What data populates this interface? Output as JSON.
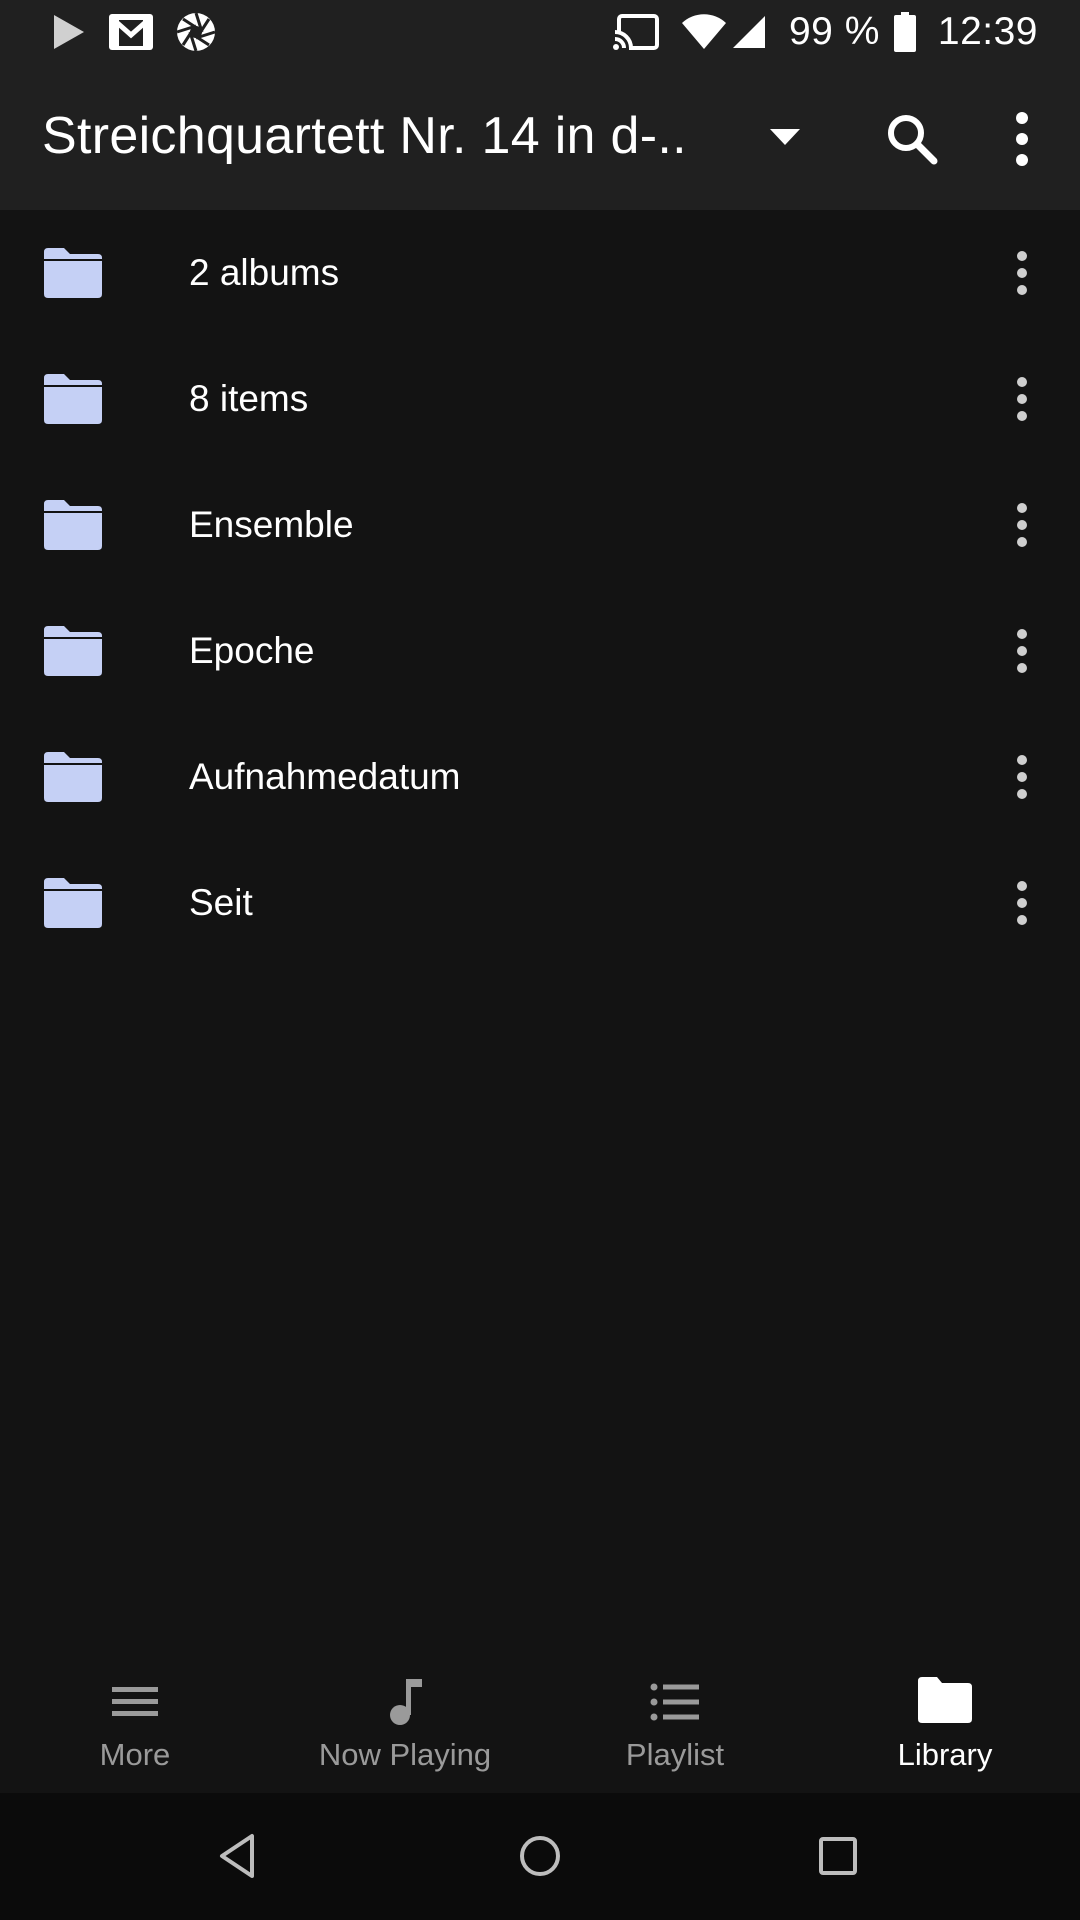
{
  "status_bar": {
    "battery_percent": "99 %",
    "time": "12:39",
    "left_icons": [
      "play-store-icon",
      "gmail-icon",
      "camera-aperture-icon"
    ],
    "right_icons": [
      "cast-icon",
      "wifi-icon",
      "cell-signal-icon",
      "battery-icon"
    ]
  },
  "app_bar": {
    "title": "Streichquartett Nr. 14 in d-.."
  },
  "folders": [
    {
      "label": "2 albums"
    },
    {
      "label": "8 items"
    },
    {
      "label": "Ensemble"
    },
    {
      "label": "Epoche"
    },
    {
      "label": "Aufnahmedatum"
    },
    {
      "label": "Seit"
    }
  ],
  "bottom_nav": {
    "items": [
      {
        "label": "More",
        "icon": "hamburger-icon"
      },
      {
        "label": "Now Playing",
        "icon": "music-note-icon"
      },
      {
        "label": "Playlist",
        "icon": "list-icon"
      },
      {
        "label": "Library",
        "icon": "folder-icon",
        "active": true
      }
    ]
  },
  "colors": {
    "background": "#131313",
    "bar": "#202020",
    "folder": "#c5d0f5",
    "inactive_label": "#9a9a9a",
    "active_label": "#ffffff"
  }
}
